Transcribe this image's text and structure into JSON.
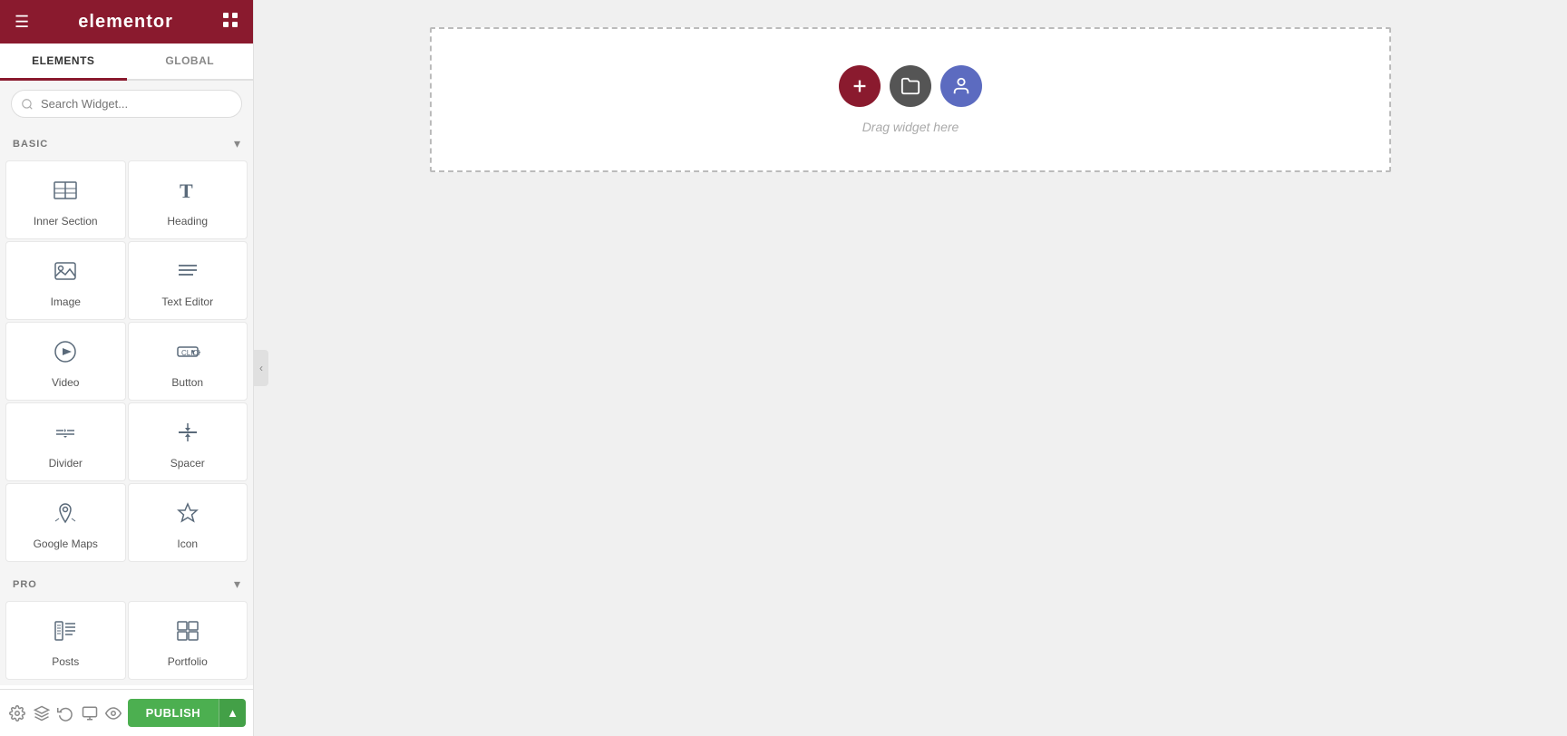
{
  "header": {
    "logo": "elementor",
    "hamburger": "☰",
    "grid": "⊞"
  },
  "tabs": [
    {
      "id": "elements",
      "label": "ELEMENTS",
      "active": true
    },
    {
      "id": "global",
      "label": "GLOBAL",
      "active": false
    }
  ],
  "search": {
    "placeholder": "Search Widget..."
  },
  "sections": {
    "basic": {
      "title": "BASIC",
      "widgets": [
        {
          "id": "inner-section",
          "label": "Inner Section",
          "icon": "inner-section-icon"
        },
        {
          "id": "heading",
          "label": "Heading",
          "icon": "heading-icon"
        },
        {
          "id": "image",
          "label": "Image",
          "icon": "image-icon"
        },
        {
          "id": "text-editor",
          "label": "Text Editor",
          "icon": "text-editor-icon"
        },
        {
          "id": "video",
          "label": "Video",
          "icon": "video-icon"
        },
        {
          "id": "button",
          "label": "Button",
          "icon": "button-icon"
        },
        {
          "id": "divider",
          "label": "Divider",
          "icon": "divider-icon"
        },
        {
          "id": "spacer",
          "label": "Spacer",
          "icon": "spacer-icon"
        },
        {
          "id": "google-maps",
          "label": "Google Maps",
          "icon": "google-maps-icon"
        },
        {
          "id": "icon",
          "label": "Icon",
          "icon": "icon-icon"
        }
      ]
    },
    "pro": {
      "title": "PRO",
      "widgets": [
        {
          "id": "posts",
          "label": "Posts",
          "icon": "posts-icon"
        },
        {
          "id": "portfolio",
          "label": "Portfolio",
          "icon": "portfolio-icon"
        }
      ]
    }
  },
  "canvas": {
    "drag_hint": "Drag widget here"
  },
  "bottom": {
    "publish_label": "PUBLISH"
  }
}
